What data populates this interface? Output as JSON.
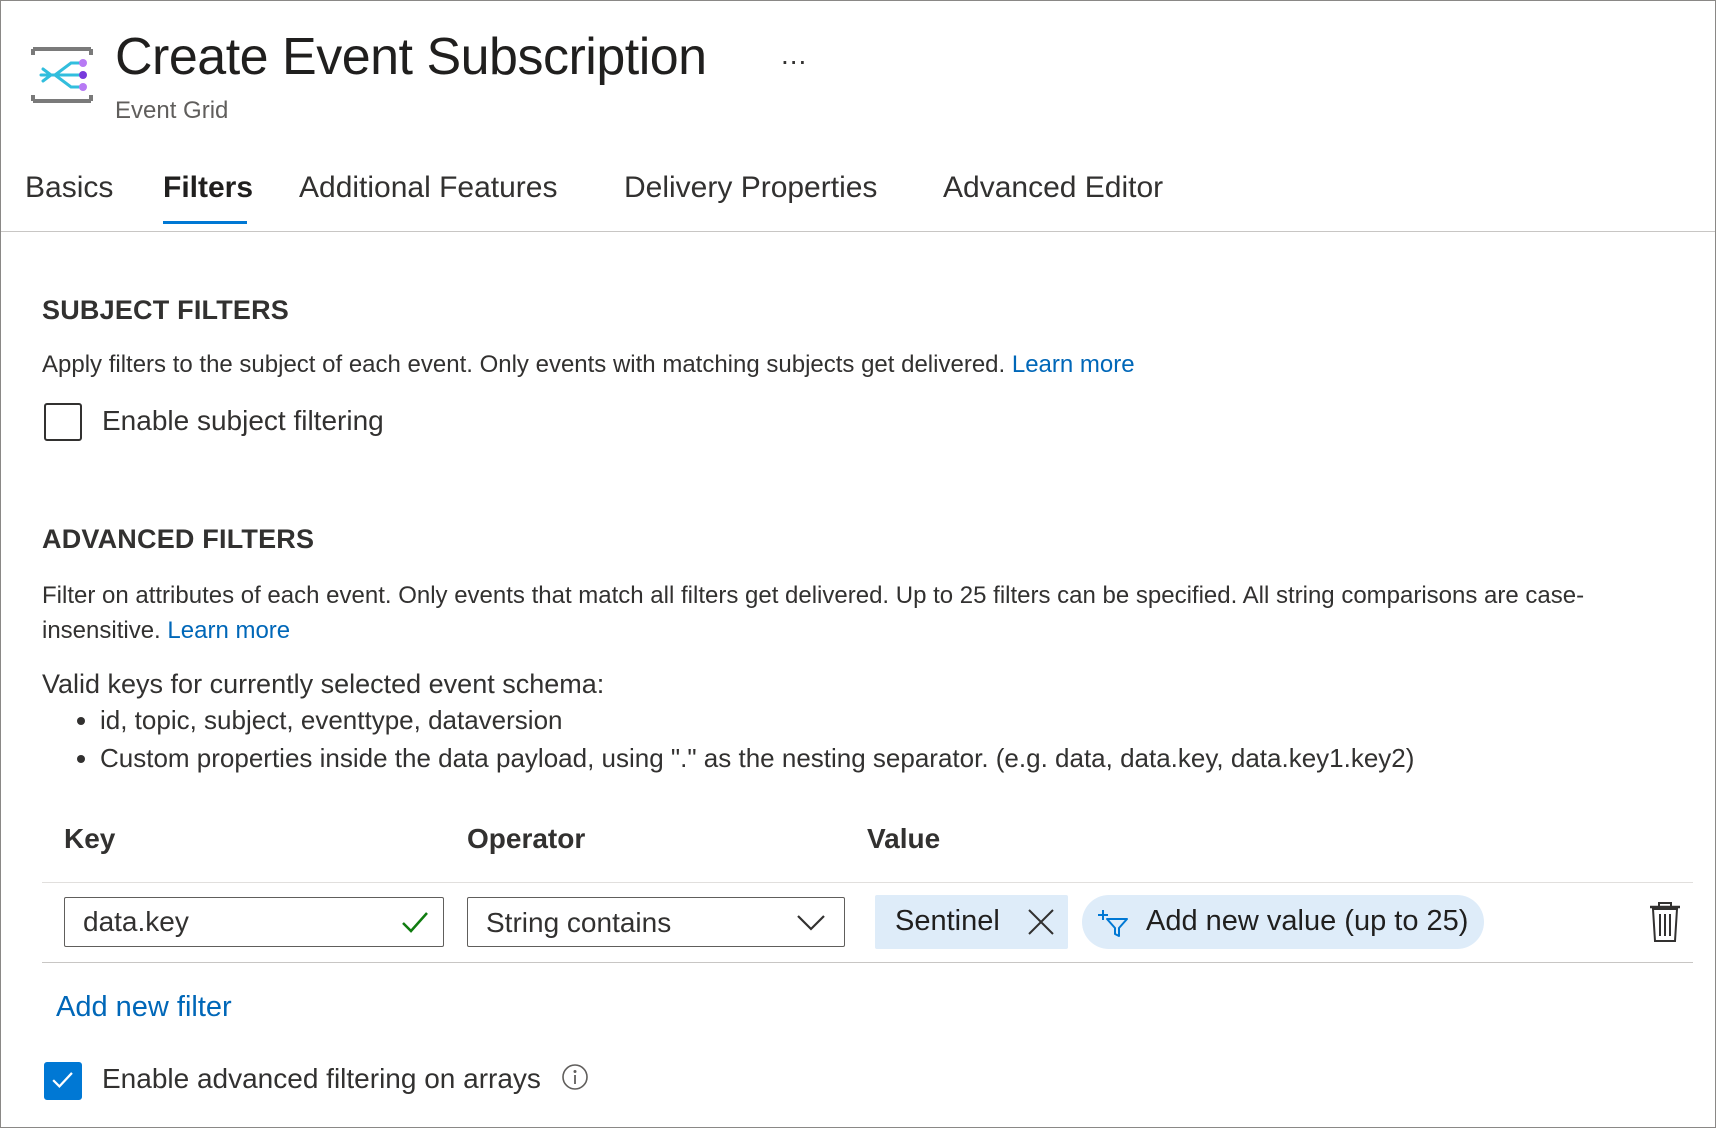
{
  "header": {
    "title": "Create Event Subscription",
    "subtitle": "Event Grid",
    "more_label": "...",
    "icon": "event-grid-icon"
  },
  "tabs": [
    {
      "label": "Basics",
      "active": false
    },
    {
      "label": "Filters",
      "active": true
    },
    {
      "label": "Additional Features",
      "active": false
    },
    {
      "label": "Delivery Properties",
      "active": false
    },
    {
      "label": "Advanced Editor",
      "active": false
    }
  ],
  "subject_filters": {
    "heading": "SUBJECT FILTERS",
    "description": "Apply filters to the subject of each event. Only events with matching subjects get delivered.",
    "learn_more": "Learn more",
    "checkbox_label": "Enable subject filtering",
    "checked": false
  },
  "advanced_filters": {
    "heading": "ADVANCED FILTERS",
    "description": "Filter on attributes of each event. Only events that match all filters get delivered. Up to 25 filters can be specified. All string comparisons are case-insensitive.",
    "learn_more": "Learn more",
    "valid_keys_label": "Valid keys for currently selected event schema:",
    "bullets": [
      "id, topic, subject, eventtype, dataversion",
      "Custom properties inside the data payload, using \".\" as the nesting separator. (e.g. data, data.key, data.key1.key2)"
    ],
    "table": {
      "columns": [
        "Key",
        "Operator",
        "Value"
      ],
      "row": {
        "key": "data.key",
        "operator": "String contains",
        "values": [
          "Sentinel"
        ],
        "add_value_label": "Add new value (up to 25)"
      }
    },
    "add_filter_label": "Add new filter",
    "array_checkbox_label": "Enable advanced filtering on arrays",
    "array_checked": true
  },
  "colors": {
    "accent": "#0078d4",
    "link": "#0067b8",
    "chip_bg": "#deecf9",
    "valid_check": "#107c10"
  }
}
